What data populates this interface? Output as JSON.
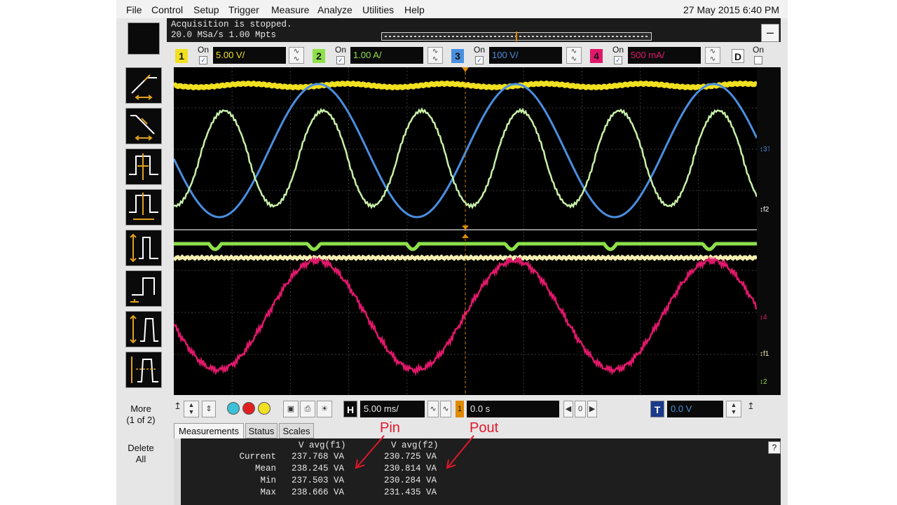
{
  "menubar": {
    "items": [
      "File",
      "Control",
      "Setup",
      "Trigger",
      "Measure",
      "Analyze",
      "Utilities",
      "Help"
    ],
    "datetime": "27 May 2015  6:40 PM"
  },
  "acquisition": {
    "status": "Acquisition is stopped.",
    "rate": "20.0 MSa/s   1.00 Mpts"
  },
  "collapse_label": "–",
  "channels": [
    {
      "num": "1",
      "on_label": "On",
      "checked": "✓",
      "scale": "5.00 V/",
      "color": "#f0e020"
    },
    {
      "num": "2",
      "on_label": "On",
      "checked": "✓",
      "scale": "1.00 A/",
      "color": "#8ee04a"
    },
    {
      "num": "3",
      "on_label": "On",
      "checked": "✓",
      "scale": "100 V/",
      "color": "#4a8ee0"
    },
    {
      "num": "4",
      "on_label": "On",
      "checked": "✓",
      "scale": "500 mA/",
      "color": "#e0186a"
    },
    {
      "num": "D",
      "on_label": "On",
      "checked": "",
      "scale": "",
      "color": "#ffffff"
    }
  ],
  "coupling_glyph": "∿\n∿",
  "sidebar": {
    "more": "More\n(1 of 2)",
    "delete_all": "Delete\nAll"
  },
  "axis_markers": {
    "ch3": "↕3˥",
    "f2": "↕f2",
    "ch4": "↕4",
    "f1": "↕f1",
    "f2b": "↕2"
  },
  "controls": {
    "trig_arrow": "↥",
    "timebase_label": "H",
    "timebase": "5.00 ms/",
    "delay": "0.0 s",
    "delay_marker": "1",
    "trigger_label": "T",
    "trigger_level": "0.0 V",
    "nav_prev": "◀",
    "nav_zero": "0",
    "nav_next": "▶",
    "zoom_glyph": "∿",
    "spin": "▲\n▼"
  },
  "tabs": [
    "Measurements",
    "Status",
    "Scales"
  ],
  "help": "?",
  "measurements": {
    "col1": "V avg(f1)",
    "col2": "V avg(f2)",
    "rows": [
      {
        "label": "Current",
        "v1": "237.768 VA",
        "v2": "230.725 VA"
      },
      {
        "label": "Mean",
        "v1": "238.245 VA",
        "v2": "230.814 VA"
      },
      {
        "label": "Min",
        "v1": "237.503 VA",
        "v2": "230.284 VA"
      },
      {
        "label": "Max",
        "v1": "238.666 VA",
        "v2": "231.435 VA"
      }
    ]
  },
  "annotations": {
    "pin": "Pin",
    "pout": "Pout",
    "color": "#e0182a"
  },
  "trace_colors": {
    "ch1": "#f0e020",
    "ch3": "#4a8ee0",
    "math_light": "#c8f0a8",
    "ch2": "#8ee04a",
    "ch2_light": "#f4efb0",
    "ch4": "#e0186a",
    "grid": "#3a3a3a",
    "marker": "#e08a00"
  }
}
